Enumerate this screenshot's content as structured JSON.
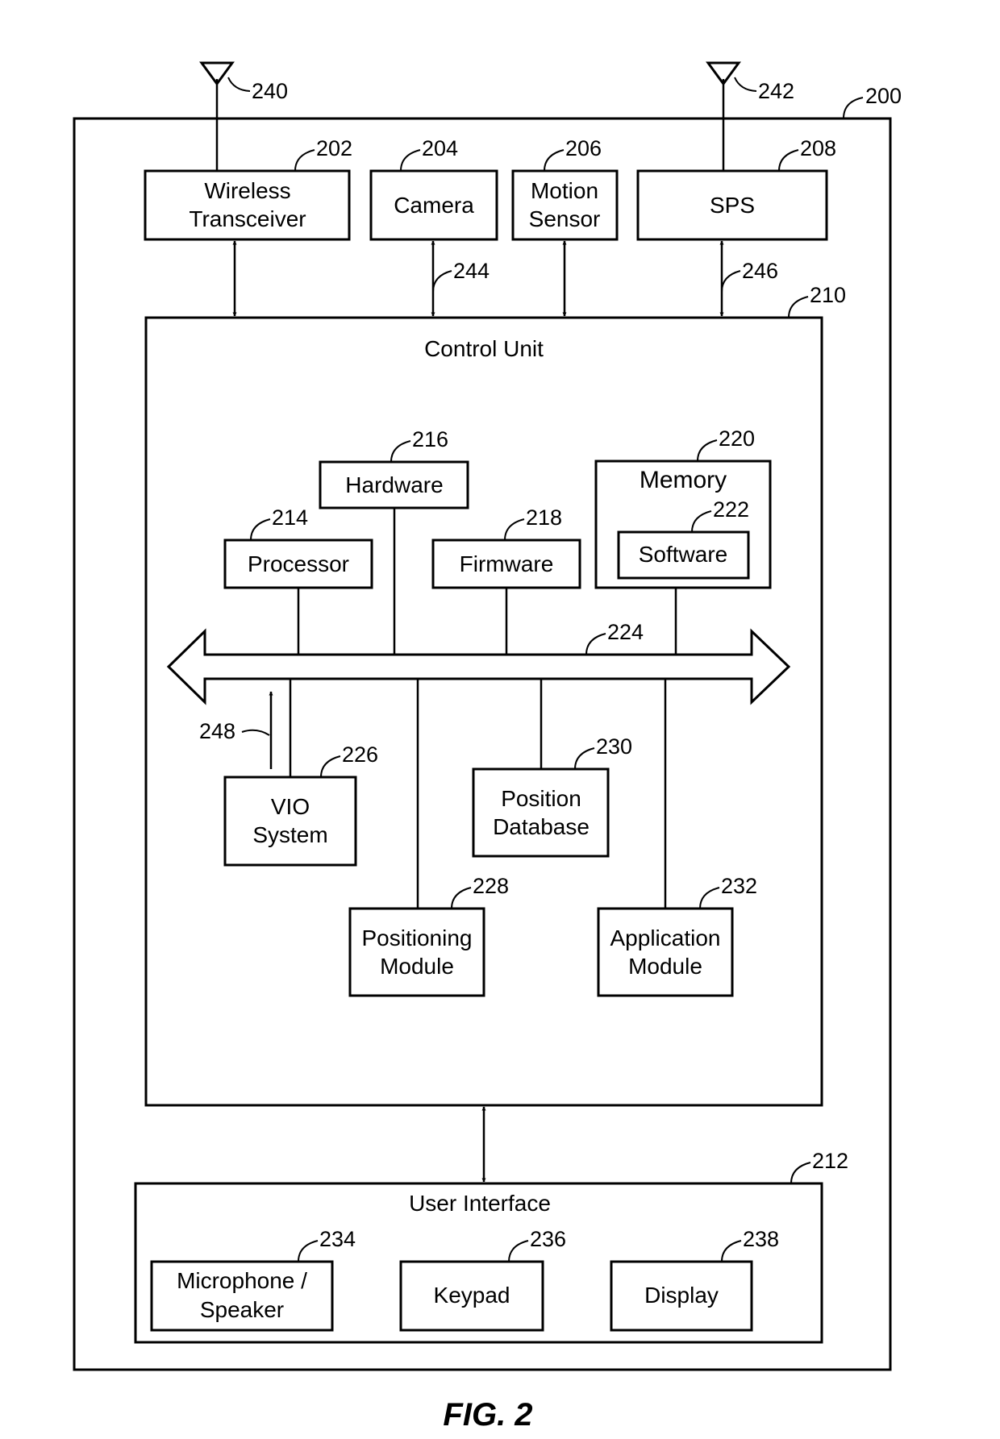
{
  "figure": {
    "caption": "FIG. 2",
    "device_ref": "200",
    "antennas": [
      {
        "ref": "240",
        "attached_to": "Wireless Transceiver"
      },
      {
        "ref": "242",
        "attached_to": "SPS"
      }
    ],
    "top_blocks": [
      {
        "id": "wireless",
        "ref": "202",
        "lines": [
          "Wireless",
          "Transceiver"
        ]
      },
      {
        "id": "camera",
        "ref": "204",
        "lines": [
          "Camera"
        ]
      },
      {
        "id": "motion",
        "ref": "206",
        "lines": [
          "Motion",
          "Sensor"
        ]
      },
      {
        "id": "sps",
        "ref": "208",
        "lines": [
          "SPS"
        ]
      }
    ],
    "link_refs": {
      "camera_link": "244",
      "sps_link": "246",
      "vio_arrow": "248"
    },
    "control_unit": {
      "ref": "210",
      "title": "Control Unit",
      "bus_ref": "224",
      "upper_blocks": [
        {
          "id": "processor",
          "ref": "214",
          "lines": [
            "Processor"
          ]
        },
        {
          "id": "hardware",
          "ref": "216",
          "lines": [
            "Hardware"
          ]
        },
        {
          "id": "firmware",
          "ref": "218",
          "lines": [
            "Firmware"
          ]
        },
        {
          "id": "memory",
          "ref": "220",
          "lines": [
            "Memory"
          ],
          "child": {
            "id": "software",
            "ref": "222",
            "lines": [
              "Software"
            ]
          }
        }
      ],
      "lower_blocks": [
        {
          "id": "vio",
          "ref": "226",
          "lines": [
            "VIO",
            "System"
          ]
        },
        {
          "id": "positioning",
          "ref": "228",
          "lines": [
            "Positioning",
            "Module"
          ]
        },
        {
          "id": "position_db",
          "ref": "230",
          "lines": [
            "Position",
            "Database"
          ]
        },
        {
          "id": "application",
          "ref": "232",
          "lines": [
            "Application",
            "Module"
          ]
        }
      ]
    },
    "user_interface": {
      "ref": "212",
      "title": "User Interface",
      "blocks": [
        {
          "id": "mic",
          "ref": "234",
          "lines": [
            "Microphone /",
            "Speaker"
          ]
        },
        {
          "id": "keypad",
          "ref": "236",
          "lines": [
            "Keypad"
          ]
        },
        {
          "id": "display",
          "ref": "238",
          "lines": [
            "Display"
          ]
        }
      ]
    }
  }
}
